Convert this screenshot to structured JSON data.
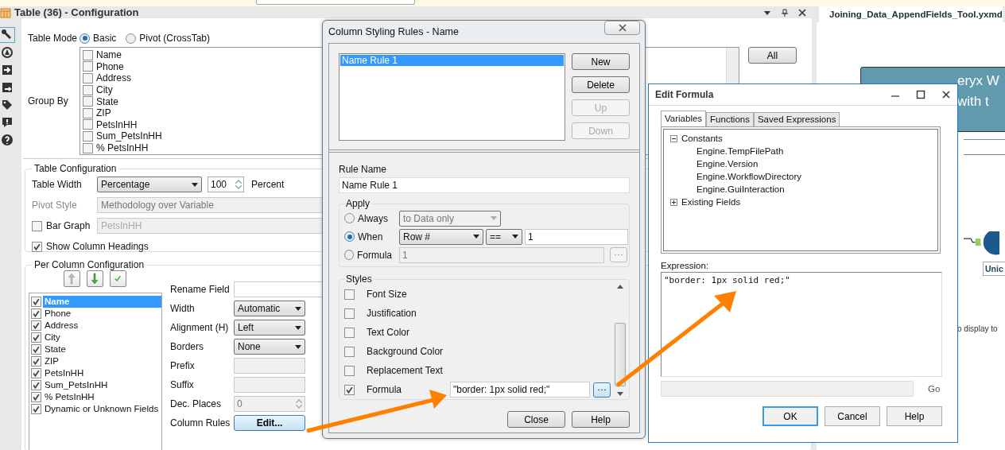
{
  "config_panel": {
    "title": "Table (36) - Configuration"
  },
  "table_mode": {
    "label": "Table Mode",
    "options": [
      {
        "label": "Basic",
        "selected": true
      },
      {
        "label": "Pivot (CrossTab)",
        "selected": false
      }
    ]
  },
  "group_by": {
    "label": "Group By",
    "button": "All",
    "fields": [
      {
        "label": "Name",
        "checked": false
      },
      {
        "label": "Phone",
        "checked": false
      },
      {
        "label": "Address",
        "checked": false
      },
      {
        "label": "City",
        "checked": false
      },
      {
        "label": "State",
        "checked": false
      },
      {
        "label": "ZIP",
        "checked": false
      },
      {
        "label": "PetsInHH",
        "checked": false
      },
      {
        "label": "Sum_PetsInHH",
        "checked": false
      },
      {
        "label": "% PetsInHH",
        "checked": false
      }
    ]
  },
  "table_configuration": {
    "title": "Table Configuration",
    "table_width": {
      "label": "Table Width",
      "value": "Percentage",
      "number": "100",
      "unit": "Percent"
    },
    "pivot_style": {
      "label": "Pivot Style",
      "value": "Methodology over Variable",
      "disabled": true
    },
    "bar_graph": {
      "label": "Bar Graph",
      "checked": false,
      "value": "PetsInHH"
    },
    "show_headings": {
      "label": "Show Column Headings",
      "checked": true
    }
  },
  "per_column": {
    "title": "Per Column Configuration",
    "columns": [
      {
        "label": "Name",
        "checked": true,
        "selected": true
      },
      {
        "label": "Phone",
        "checked": true,
        "selected": false
      },
      {
        "label": "Address",
        "checked": true,
        "selected": false
      },
      {
        "label": "City",
        "checked": true,
        "selected": false
      },
      {
        "label": "State",
        "checked": true,
        "selected": false
      },
      {
        "label": "ZIP",
        "checked": true,
        "selected": false
      },
      {
        "label": "PetsInHH",
        "checked": true,
        "selected": false
      },
      {
        "label": "Sum_PetsInHH",
        "checked": true,
        "selected": false
      },
      {
        "label": "% PetsInHH",
        "checked": true,
        "selected": false
      },
      {
        "label": "Dynamic or Unknown Fields",
        "checked": true,
        "selected": false
      }
    ],
    "fields": [
      {
        "label": "Rename Field",
        "kind": "text",
        "disabled": false
      },
      {
        "label": "Width",
        "kind": "select",
        "value": "Automatic",
        "disabled": false
      },
      {
        "label": "Alignment (H)",
        "kind": "select",
        "value": "Left",
        "disabled": false
      },
      {
        "label": "Borders",
        "kind": "select",
        "value": "None",
        "disabled": false
      },
      {
        "label": "Prefix",
        "kind": "text",
        "disabled": true
      },
      {
        "label": "Suffix",
        "kind": "text",
        "disabled": true
      },
      {
        "label": "Dec. Places",
        "kind": "spin",
        "value": "0",
        "disabled": true
      },
      {
        "label": "Column Rules",
        "kind": "button",
        "value": "Edit..."
      }
    ]
  },
  "styling_dialog": {
    "title": "Column Styling Rules - Name",
    "rules": [
      {
        "label": "Name Rule 1",
        "selected": true
      }
    ],
    "buttons": [
      {
        "label": "New",
        "disabled": false
      },
      {
        "label": "Delete",
        "disabled": false
      },
      {
        "label": "Up",
        "disabled": true
      },
      {
        "label": "Down",
        "disabled": true
      }
    ],
    "rule_name": {
      "label": "Rule Name",
      "value": "Name Rule 1"
    },
    "apply": {
      "title": "Apply",
      "options": [
        {
          "kind": "always",
          "label": "Always",
          "selected": false,
          "value": "to Data only"
        },
        {
          "kind": "when",
          "label": "When",
          "selected": true,
          "field": "Row #",
          "operator": "==",
          "value": "1"
        },
        {
          "kind": "formula",
          "label": "Formula",
          "selected": false,
          "value": "1"
        }
      ]
    },
    "styles": {
      "title": "Styles",
      "items": [
        {
          "label": "Font Size",
          "checked": false
        },
        {
          "label": "Justification",
          "checked": false
        },
        {
          "label": "Text Color",
          "checked": false
        },
        {
          "label": "Background Color",
          "checked": false
        },
        {
          "label": "Replacement Text",
          "checked": false
        },
        {
          "label": "Formula",
          "checked": true,
          "value": "\"border: 1px solid red;\""
        }
      ]
    },
    "footer_buttons": [
      "Close",
      "Help"
    ]
  },
  "formula_dialog": {
    "title": "Edit Formula",
    "tabs": [
      {
        "label": "Variables",
        "selected": true
      },
      {
        "label": "Functions",
        "selected": false
      },
      {
        "label": "Saved Expressions",
        "selected": false
      }
    ],
    "tree": [
      {
        "label": "Constants",
        "expanded": true,
        "children": [
          {
            "label": "Engine.TempFilePath"
          },
          {
            "label": "Engine.Version"
          },
          {
            "label": "Engine.WorkflowDirectory"
          },
          {
            "label": "Engine.GuiInteraction"
          }
        ]
      },
      {
        "label": "Existing Fields",
        "expanded": false
      }
    ],
    "expression_label": "Expression:",
    "expression": "\"border: 1px solid red;\"",
    "go": "Go",
    "buttons": [
      {
        "label": "OK",
        "default": true
      },
      {
        "label": "Cancel",
        "default": false
      },
      {
        "label": "Help",
        "default": false
      }
    ]
  },
  "workflow": {
    "tab": "Joining_Data_AppendFields_Tool.yxmd",
    "banner_lines": [
      "eryx W",
      "with t"
    ],
    "node_label": "Unic",
    "hint": "o display to"
  }
}
